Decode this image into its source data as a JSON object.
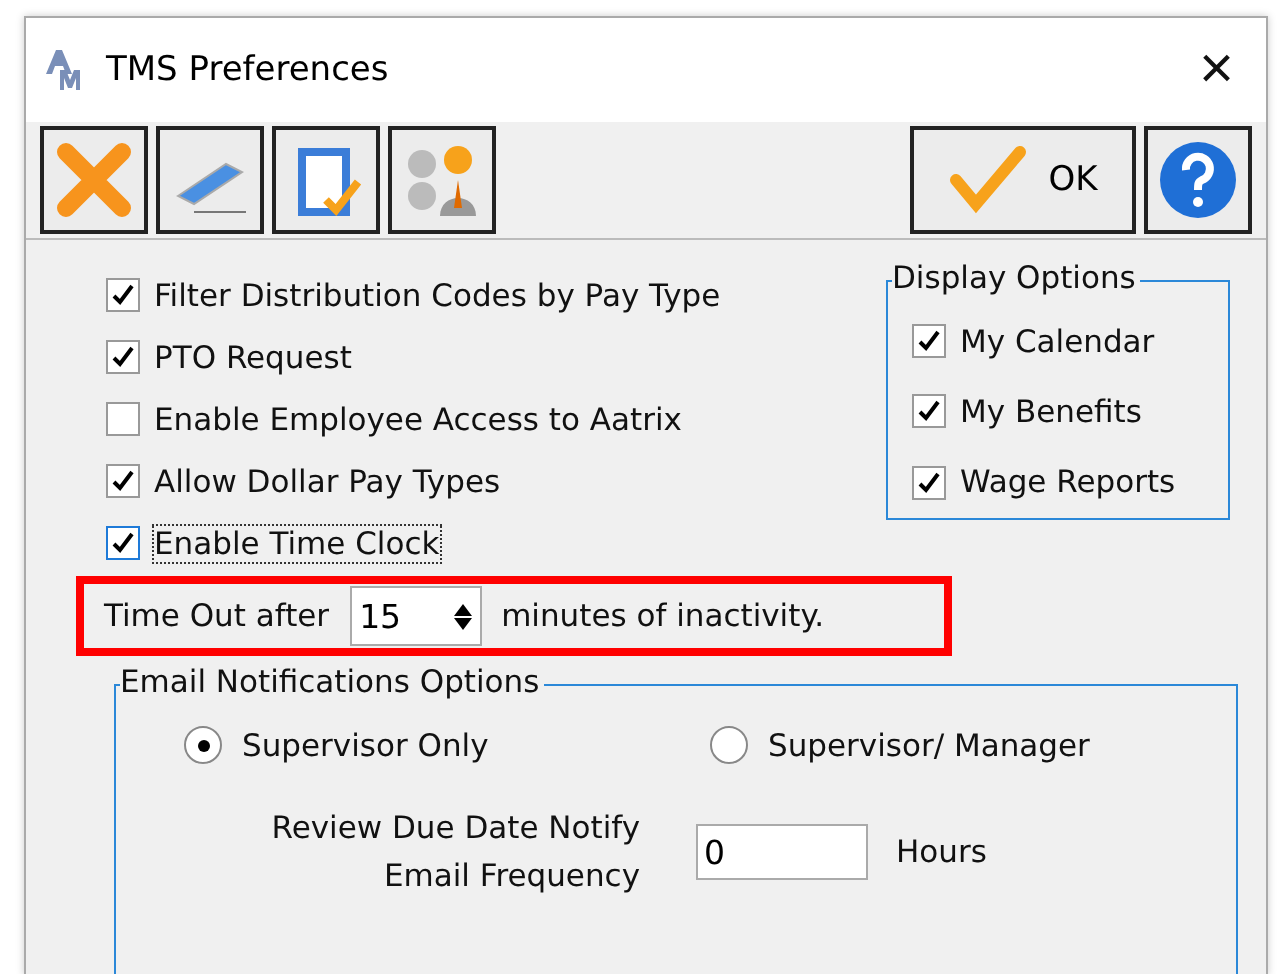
{
  "window": {
    "title": "TMS Preferences",
    "close": "×"
  },
  "toolbar": {
    "tools": [
      {
        "kind": "cancel"
      },
      {
        "kind": "eraser"
      },
      {
        "kind": "clipboard"
      },
      {
        "kind": "users"
      }
    ],
    "ok": "OK"
  },
  "options": [
    {
      "label": "Filter Distribution Codes by Pay Type",
      "checked": true,
      "focused": false
    },
    {
      "label": "PTO Request",
      "checked": true,
      "focused": false
    },
    {
      "label": "Enable Employee Access to Aatrix",
      "checked": false,
      "focused": false
    },
    {
      "label": "Allow Dollar Pay Types",
      "checked": true,
      "focused": false
    },
    {
      "label": "Enable Time Clock",
      "checked": true,
      "focused": true
    }
  ],
  "display_options": {
    "title": "Display Options",
    "items": [
      {
        "label": "My Calendar",
        "checked": true
      },
      {
        "label": "My Benefits",
        "checked": true
      },
      {
        "label": "Wage Reports",
        "checked": true
      }
    ]
  },
  "timeout": {
    "prefix": "Time Out after",
    "value": "15",
    "suffix": "minutes of inactivity."
  },
  "email": {
    "title": "Email Notifications Options",
    "radios": [
      {
        "label": "Supervisor Only",
        "selected": true
      },
      {
        "label": "Supervisor/ Manager",
        "selected": false
      }
    ],
    "frequency_label": [
      "Review Due Date Notify",
      "Email Frequency"
    ],
    "frequency_value": "0",
    "unit": "Hours"
  }
}
